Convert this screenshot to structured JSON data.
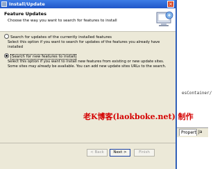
{
  "background": {
    "code_snippet": "esContainer/",
    "tabs": [
      "Propert",
      "Ja"
    ]
  },
  "dialog": {
    "title": "Install/Update",
    "close_glyph": "×",
    "header_title": "Feature Updates",
    "header_desc": "Choose the way you want to search for features to install",
    "options": [
      {
        "label": "Search for updates of the currently installed features",
        "checked": false,
        "description": [
          "Select this option if you want to search for updates of the features you already have",
          "installed"
        ]
      },
      {
        "label": "Search for new features to install",
        "checked": true,
        "description": [
          "Select this option if you want to install new features from existing or new update sites.",
          "Some sites may already be available. You can add new update sites URLs to the search."
        ]
      }
    ],
    "buttons": {
      "back": "< Back",
      "next": "Next >",
      "finish": "Finish"
    }
  },
  "watermark": "老K博客(laokboke.net) 制作",
  "colors": {
    "titlebar": "#1f56c8",
    "dialog_bg": "#ece9d8",
    "watermark": "#d40000"
  }
}
